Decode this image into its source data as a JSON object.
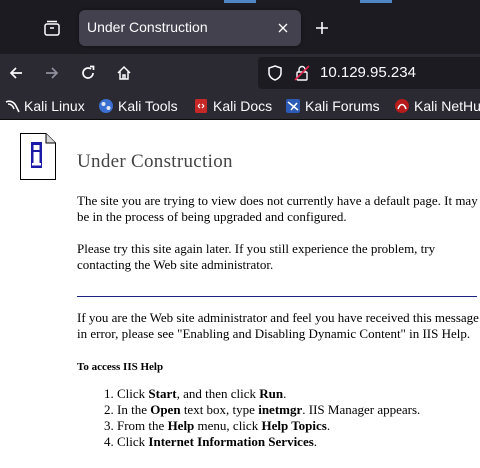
{
  "browser": {
    "tab": {
      "title": "Under Construction"
    },
    "address": {
      "url": "10.129.95.234"
    },
    "bookmarks": [
      {
        "label": "Kali Linux",
        "icon": "kali-dragon-icon"
      },
      {
        "label": "Kali Tools",
        "icon": "kali-tools-icon"
      },
      {
        "label": "Kali Docs",
        "icon": "kali-docs-icon"
      },
      {
        "label": "Kali Forums",
        "icon": "kali-forums-icon"
      },
      {
        "label": "Kali NetHu",
        "icon": "kali-nethunter-icon"
      }
    ],
    "colors": {
      "tabbar": "#1c1b22",
      "toolbar": "#2b2a33",
      "active_tab": "#42414d",
      "text": "#fbfbfe"
    }
  },
  "page": {
    "title": "Under Construction",
    "para1": "The site you are trying to view does not currently have a default page. It may be in the process of being upgraded and configured.",
    "para2": "Please try this site again later. If you still experience the problem, try contacting the Web site administrator.",
    "para3": "If you are the Web site administrator and feel you have received this message in error, please see \"Enabling and Disabling Dynamic Content\" in IIS Help.",
    "help_heading": "To access IIS Help",
    "steps": [
      {
        "pre": "Click ",
        "bold": "Start",
        "mid": ", and then click ",
        "bold2": "Run",
        "post": "."
      },
      {
        "pre": "In the ",
        "bold": "Open",
        "mid": " text box, type ",
        "bold2": "inetmgr",
        "post": ". IIS Manager appears."
      },
      {
        "pre": "From the ",
        "bold": "Help",
        "mid": " menu, click ",
        "bold2": "Help Topics",
        "post": "."
      },
      {
        "pre": "Click ",
        "bold": "Internet Information Services",
        "mid": "",
        "bold2": "",
        "post": "."
      }
    ],
    "colors": {
      "rule": "#1a237e",
      "title": "#444444"
    }
  }
}
